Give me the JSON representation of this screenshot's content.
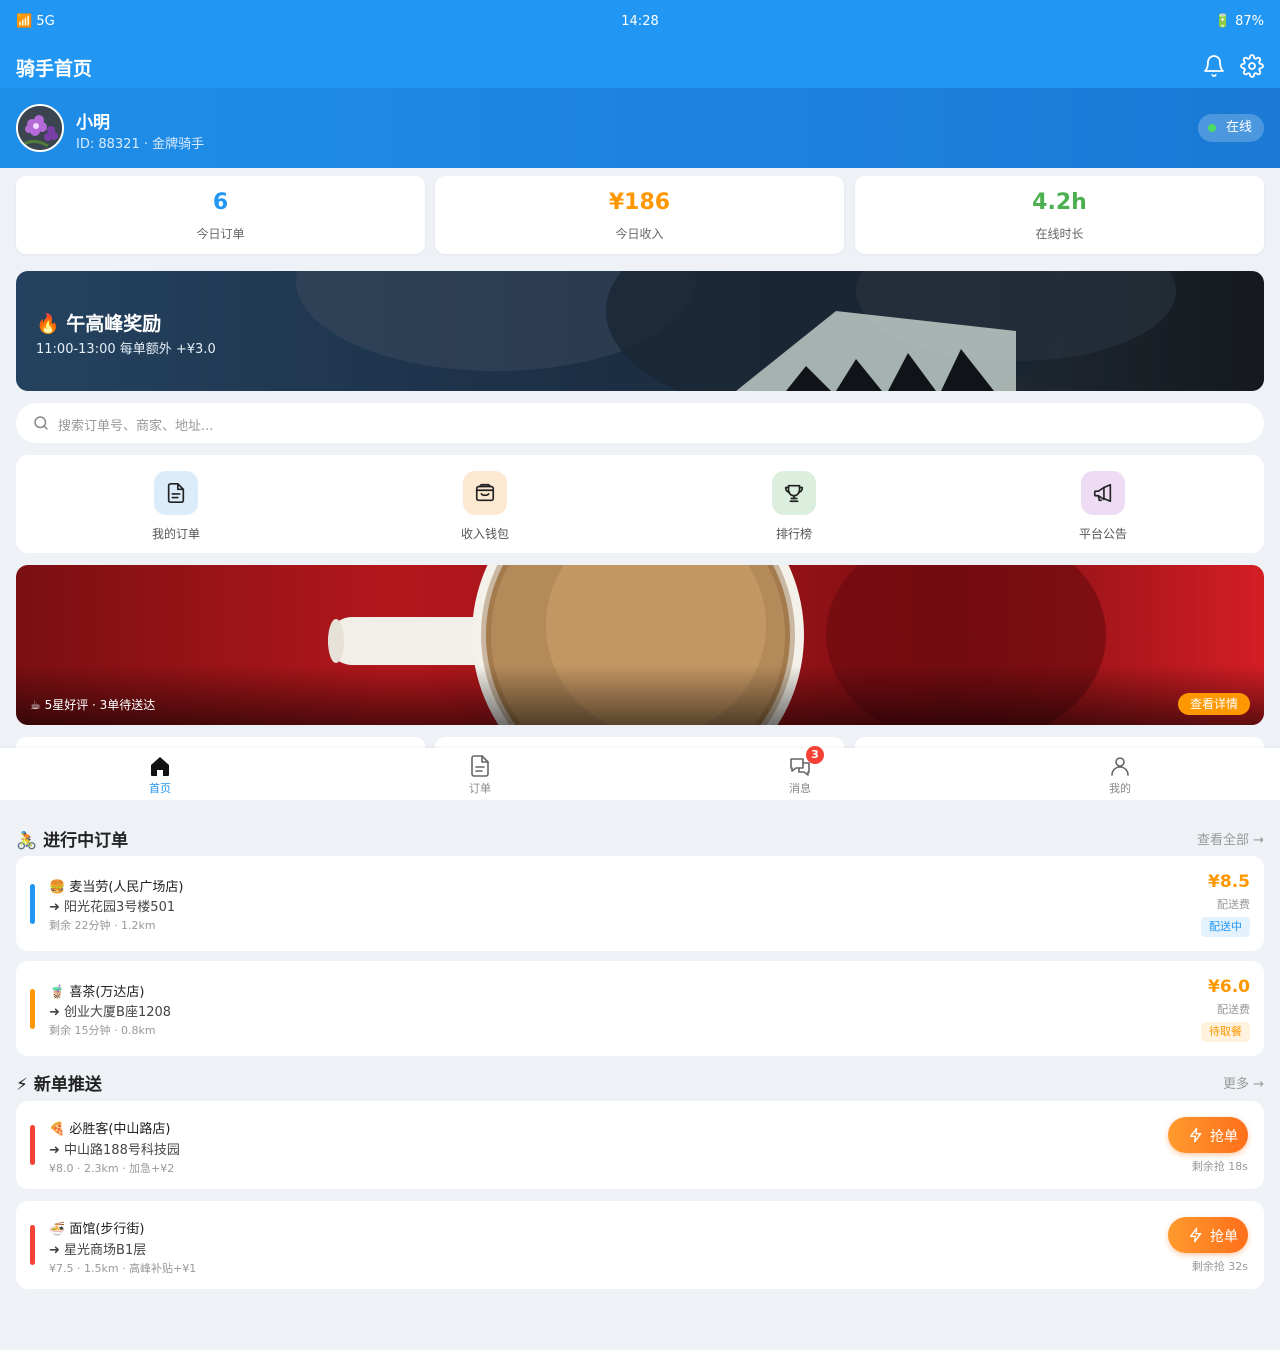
{
  "status_bar": {
    "network": "📶 5G",
    "time": "14:28",
    "battery": "🔋 87%"
  },
  "app_bar": {
    "title": "骑手首页"
  },
  "profile": {
    "name": "小明",
    "subtitle": "ID: 88321 · 金牌骑手",
    "status": "在线"
  },
  "stats": [
    {
      "value": "6",
      "label": "今日订单",
      "color": "#2196f3"
    },
    {
      "value": "¥186",
      "label": "今日收入",
      "color": "#ff9800"
    },
    {
      "value": "4.2h",
      "label": "在线时长",
      "color": "#4caf50"
    }
  ],
  "promo_banner": {
    "title": "🔥 午高峰奖励",
    "subtitle": "11:00-13:00 每单额外 +¥3.0"
  },
  "search": {
    "placeholder": "搜索订单号、商家、地址..."
  },
  "quick_actions": [
    {
      "label": "我的订单",
      "icon": "document-icon",
      "bg": "#dcecfb"
    },
    {
      "label": "收入钱包",
      "icon": "wallet-icon",
      "bg": "#fde8d2"
    },
    {
      "label": "排行榜",
      "icon": "trophy-icon",
      "bg": "#dcefdf"
    },
    {
      "label": "平台公告",
      "icon": "megaphone-icon",
      "bg": "#eddcf3"
    }
  ],
  "image_banner": {
    "caption": "☕ 5星好评 · 3单待送达",
    "badge": "查看详情"
  },
  "tab_bar": {
    "tabs": [
      {
        "label": "首页",
        "icon": "home-icon",
        "active": true
      },
      {
        "label": "订单",
        "icon": "document-icon",
        "active": false
      },
      {
        "label": "消息",
        "icon": "chat-icon",
        "active": false,
        "badge": "3"
      },
      {
        "label": "我的",
        "icon": "user-icon",
        "active": false
      }
    ]
  },
  "in_progress": {
    "title": "🚴 进行中订单",
    "link": "查看全部 →",
    "orders": [
      {
        "shop": "🍔 麦当劳(人民广场店)",
        "dest": "➜ 阳光花园3号楼501",
        "meta": "剩余 22分钟 · 1.2km",
        "price": "¥8.5",
        "price_label": "配送费",
        "status": "配送中",
        "bar_color": "#2196f3",
        "status_color": "#2196f3",
        "status_bg": "#e3f2fd"
      },
      {
        "shop": "🧋 喜茶(万达店)",
        "dest": "➜ 创业大厦B座1208",
        "meta": "剩余 15分钟 · 0.8km",
        "price": "¥6.0",
        "price_label": "配送费",
        "status": "待取餐",
        "bar_color": "#ff9800",
        "status_color": "#ff9800",
        "status_bg": "#fff3e0"
      }
    ]
  },
  "new_orders": {
    "title": "⚡ 新单推送",
    "link": "更多 →",
    "orders": [
      {
        "shop": "🍕 必胜客(中山路店)",
        "dest": "➜ 中山路188号科技园",
        "meta": "¥8.0 · 2.3km · 加急+¥2",
        "button": "抢单",
        "timer": "剩余抢 18s"
      },
      {
        "shop": "🍜 面馆(步行街)",
        "dest": "➜ 星光商场B1层",
        "meta": "¥7.5 · 1.5km · 高峰补贴+¥1",
        "button": "抢单",
        "timer": "剩余抢 32s"
      }
    ]
  }
}
